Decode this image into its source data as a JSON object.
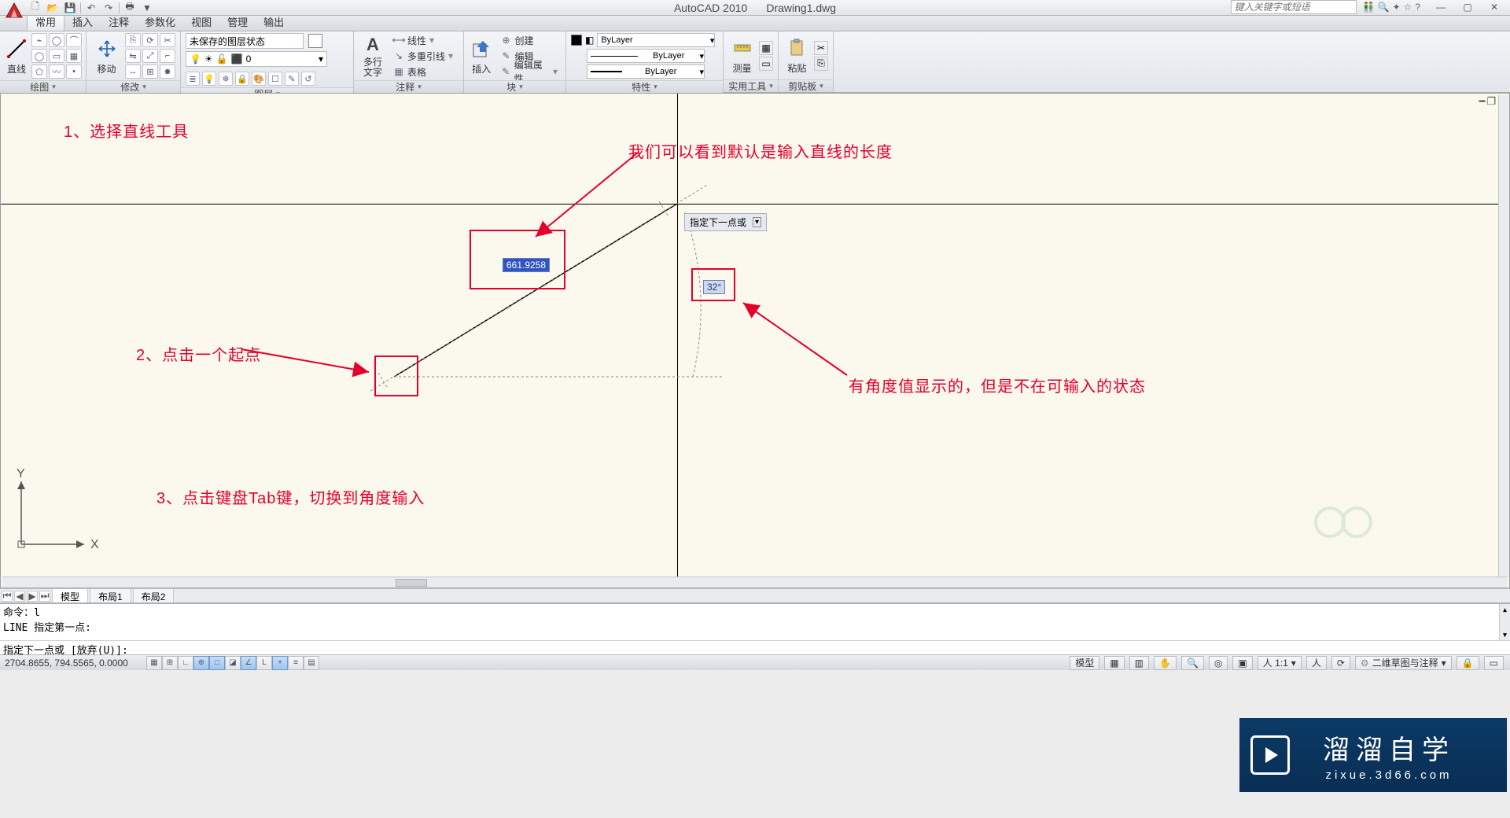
{
  "title": {
    "app": "AutoCAD 2010",
    "doc": "Drawing1.dwg"
  },
  "search_placeholder": "键入关键字或短语",
  "winctrls": {
    "min": "—",
    "max": "▢",
    "close": "✕"
  },
  "menu": [
    "常用",
    "插入",
    "注释",
    "参数化",
    "视图",
    "管理",
    "输出"
  ],
  "menu_active": 0,
  "ribbon": {
    "draw": {
      "title": "绘图",
      "line": "直线"
    },
    "modify": {
      "title": "修改",
      "move": "移动"
    },
    "layer": {
      "title": "图层",
      "state": "未保存的图层状态",
      "cur": "0"
    },
    "annot": {
      "title": "注释",
      "text": "多行\n文字",
      "linetype": "线性",
      "leader": "多重引线",
      "table": "表格"
    },
    "block": {
      "title": "块",
      "insert": "插入",
      "create": "创建",
      "edit": "编辑",
      "editattr": "编辑属性"
    },
    "prop": {
      "title": "特性",
      "bylayer": "ByLayer"
    },
    "util": {
      "title": "实用工具",
      "measure": "测量"
    },
    "clip": {
      "title": "剪贴板",
      "paste": "粘贴"
    }
  },
  "annotations": {
    "step1": "1、选择直线工具",
    "step2": "2、点击一个起点",
    "step3": "3、点击键盘Tab键，切换到角度输入",
    "note1": "我们可以看到默认是输入直线的长度",
    "note2": "有角度值显示的，但是不在可输入的状态"
  },
  "dynamic": {
    "length": "661.9258",
    "angle": "32°",
    "prompt": "指定下一点或",
    "prompt_icon": "▾"
  },
  "ucs": {
    "x": "X",
    "y": "Y"
  },
  "tabs": [
    "模型",
    "布局1",
    "布局2"
  ],
  "cmd": {
    "l1": "命令：l",
    "l2": "LINE 指定第一点:",
    "input": "指定下一点或 [放弃(U)]:"
  },
  "status": {
    "coords": "2704.8655, 794.5565, 0.0000",
    "right": {
      "model": "模型",
      "scale": "人 1:1",
      "ann": "二维草图与注释"
    }
  },
  "watermark": {
    "main": "溜溜自学",
    "sub": "zixue.3d66.com"
  }
}
